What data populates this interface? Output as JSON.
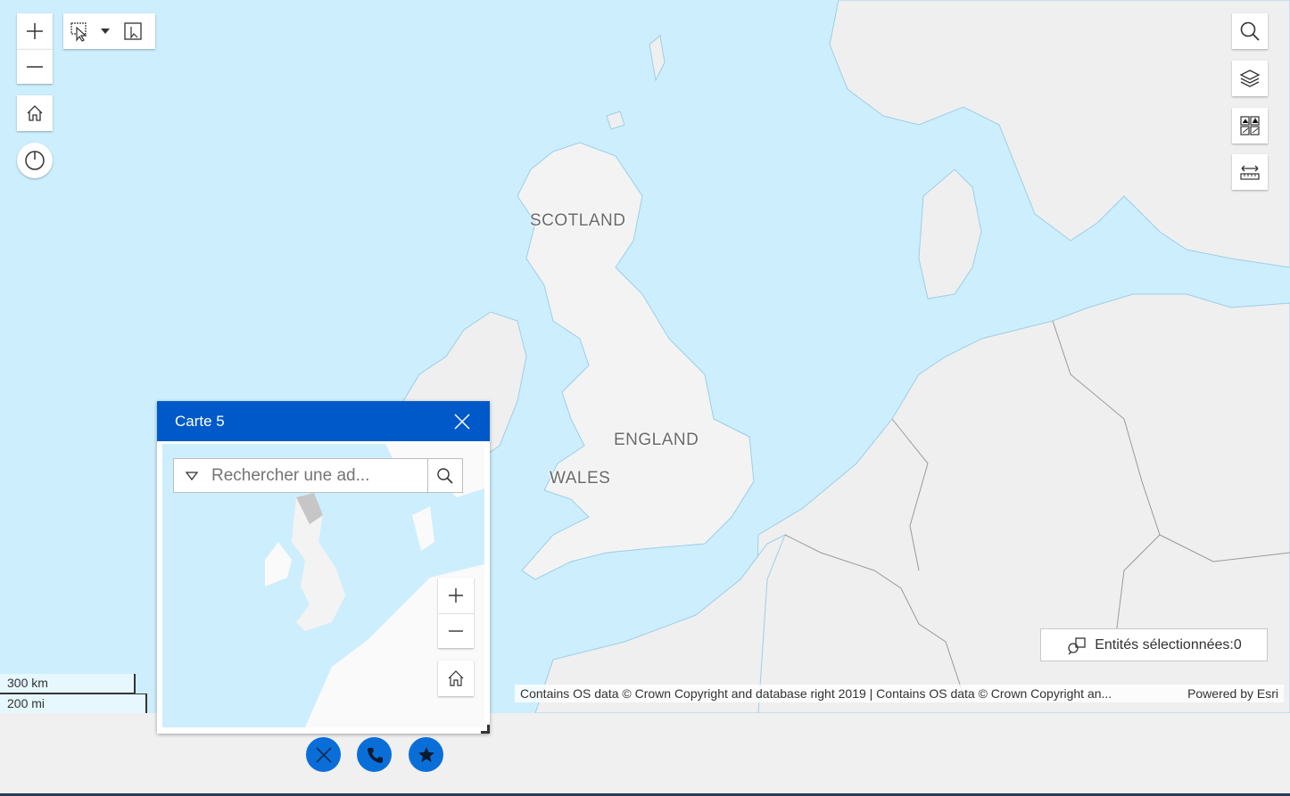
{
  "map": {
    "labels": {
      "scotland": "SCOTLAND",
      "england": "ENGLAND",
      "wales": "WALES"
    },
    "attribution": "Contains OS data © Crown Copyright and database right 2019 | Contains OS data © Crown Copyright an...",
    "powered_by": "Powered by Esri",
    "scale": {
      "km": "300 km",
      "mi": "200 mi"
    },
    "selection": {
      "label": "Entités sélectionnées:0"
    },
    "colors": {
      "water": "#cdeefd",
      "land": "#efefef",
      "accent": "#0059c9"
    }
  },
  "toolbar": {
    "zoom_in_icon": "plus-icon",
    "zoom_out_icon": "minus-icon",
    "home_icon": "home-icon",
    "locate_icon": "power-icon",
    "select_icon": "select-cursor-icon",
    "clear_icon": "clear-selection-icon"
  },
  "right_tools": [
    "search-icon",
    "layers-icon",
    "basemap-gallery-icon",
    "measure-icon"
  ],
  "panel": {
    "title": "Carte 5",
    "search_placeholder": "Rechercher une ad..."
  },
  "fabs": [
    "close-icon",
    "phone-icon",
    "star-icon"
  ]
}
